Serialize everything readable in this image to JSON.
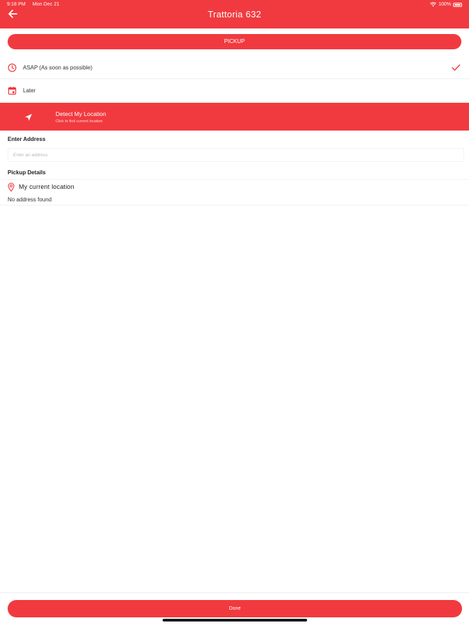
{
  "status_bar": {
    "time": "9:18 PM",
    "date": "Mon Dec 21",
    "battery": "100%"
  },
  "header": {
    "title": "Trattoria 632"
  },
  "mode": {
    "pickup_label": "PICKUP"
  },
  "timing_options": [
    {
      "label": "ASAP (As soon as possible)",
      "selected": true
    },
    {
      "label": "Later",
      "selected": false
    }
  ],
  "detect_location": {
    "title": "Detect My Location",
    "subtitle": "Click to find current location"
  },
  "enter_address": {
    "label": "Enter Address",
    "placeholder": "Enter an address",
    "value": ""
  },
  "pickup_details": {
    "label": "Pickup Details",
    "location_name": "My current location",
    "address": "No address found"
  },
  "footer": {
    "done_label": "Done"
  },
  "colors": {
    "accent": "#f13a3f",
    "background": "#ffffff"
  },
  "icons": [
    "back-arrow-icon",
    "wifi-icon",
    "battery-icon",
    "clock-icon",
    "check-icon",
    "calendar-icon",
    "navigation-arrow-icon",
    "location-pin-icon"
  ]
}
